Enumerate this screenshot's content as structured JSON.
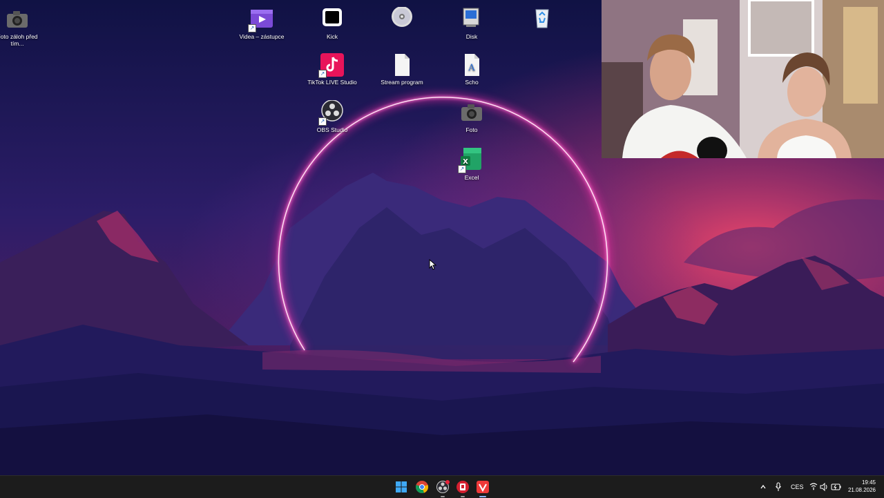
{
  "desktop_icons": {
    "foto_zaloh": "Foto záloh před tím...",
    "videa": "Videa – zástupce",
    "kick": "Kick",
    "disc": " ",
    "disk": "Disk",
    "recycle": " ",
    "tiktok": "TikTok LIVE Studio",
    "stream": "Stream program",
    "scho": "Scho",
    "obs": "OBS Studio",
    "foto": "Foto",
    "excel": "Excel"
  },
  "taskbar": {
    "language": "CES",
    "time": "19:45",
    "date": "21.08.2026",
    "apps": [
      "start-icon",
      "chrome-icon",
      "obs-icon",
      "red-app-icon",
      "vivaldi-icon"
    ]
  },
  "colors": {
    "neon_ring": "#ff2aa8",
    "sky_top": "#16114a",
    "sky_glow": "#d2336f",
    "taskbar": "#1c1c1c"
  }
}
